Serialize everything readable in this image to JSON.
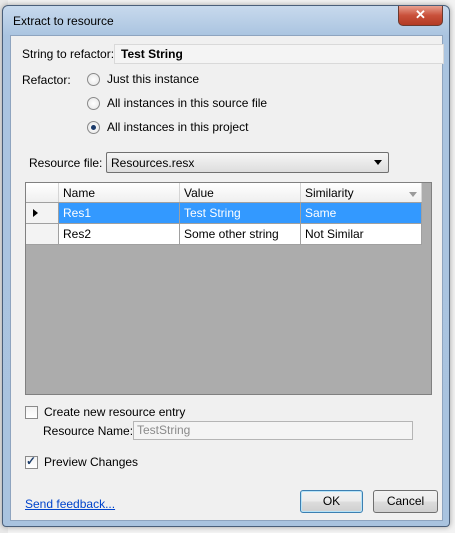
{
  "dialog": {
    "title": "Extract to resource",
    "close_glyph": "✕"
  },
  "string_to_refactor": {
    "label": "String to refactor:",
    "value": "Test String"
  },
  "refactor": {
    "label": "Refactor:",
    "options": [
      {
        "label": "Just this instance",
        "checked": false
      },
      {
        "label": "All instances in this source file",
        "checked": false
      },
      {
        "label": "All instances in this project",
        "checked": true
      }
    ]
  },
  "resource_file": {
    "label": "Resource file:",
    "selected": "Resources.resx"
  },
  "grid": {
    "columns": [
      "Name",
      "Value",
      "Similarity"
    ],
    "rows": [
      {
        "name": "Res1",
        "value": "Test String",
        "similarity": "Same",
        "selected": true
      },
      {
        "name": "Res2",
        "value": "Some other string",
        "similarity": "Not Similar",
        "selected": false
      }
    ]
  },
  "create_entry": {
    "label": "Create new resource entry",
    "checked": false
  },
  "resource_name": {
    "label": "Resource Name:",
    "value": "TestString"
  },
  "preview_changes": {
    "label": "Preview Changes",
    "checked": true
  },
  "footer": {
    "feedback_link": "Send feedback...",
    "ok_label": "OK",
    "cancel_label": "Cancel"
  },
  "colors": {
    "selection": "#3399ff",
    "grid_background": "#acacac",
    "link": "#0044cc"
  }
}
